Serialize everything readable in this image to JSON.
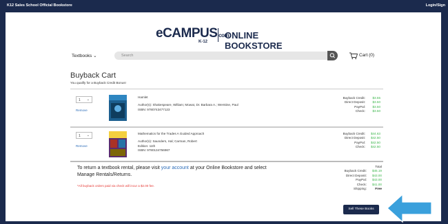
{
  "topbar": {
    "left": "K12 Sales School Official Bookstore",
    "right": "Login/Sign"
  },
  "logo": {
    "ecampus": "eCAMPUS",
    "com": ".com",
    "k12": "K-12",
    "online": "ONLINE BOOKSTORE"
  },
  "nav": {
    "textbooks": "Textbooks",
    "search_placeholder": "Search",
    "cart": "Cart (0)"
  },
  "cart": {
    "title": "Buyback Cart",
    "subtitle": "You qualify for a Buyback Credit Bonus!",
    "remove_label": "Remove",
    "items": [
      {
        "qty": "1",
        "title": "Hamlet",
        "authors": "Author(s): Shakespeare, William; Mowat, Dr. Barbara A.; Werstine, Paul",
        "edition": "",
        "isbn": "ISBN: 9780743477123",
        "prices": [
          {
            "label": "Buyback Credit:",
            "value": "$3.55"
          },
          {
            "label": "Direct Deposit:",
            "value": "$3.50"
          },
          {
            "label": "PayPal:",
            "value": "$3.50"
          },
          {
            "label": "Check:",
            "value": "$3.50"
          }
        ]
      },
      {
        "qty": "1",
        "title": "Mathematics for the Trades A Guided Approach",
        "authors": "Author(s): Saunders, Hal; Carman, Robert",
        "edition": "Edition: 11th",
        "isbn": "ISBN: 9780134756967",
        "prices": [
          {
            "label": "Buyback Credit:",
            "value": "$44.63"
          },
          {
            "label": "Direct Deposit:",
            "value": "$42.50"
          },
          {
            "label": "PayPal:",
            "value": "$42.50"
          },
          {
            "label": "Check:",
            "value": "$42.50"
          }
        ]
      }
    ],
    "return_text_1": "To return a textbook rental, please visit ",
    "return_link": "your account",
    "return_text_2": " at your Online Bookstore and select Manage Rentals/Returns.",
    "note": "*All buyback orders paid via check will incur a $2.00 fee.",
    "totals_header": "Total",
    "totals": [
      {
        "label": "Buyback Credit:",
        "value": "$45.19"
      },
      {
        "label": "Direct Deposit:",
        "value": "$43.00"
      },
      {
        "label": "PayPal:",
        "value": "$43.00"
      },
      {
        "label": "Check:",
        "value": "$41.00"
      },
      {
        "label": "Shipping:",
        "value": "Free"
      }
    ],
    "sell_button": "Sell These Books"
  },
  "colors": {
    "navy": "#1b2a4d",
    "green": "#3bb54a",
    "link": "#2a6bb8",
    "red": "#e53935",
    "arrow": "#3aa0dc"
  }
}
